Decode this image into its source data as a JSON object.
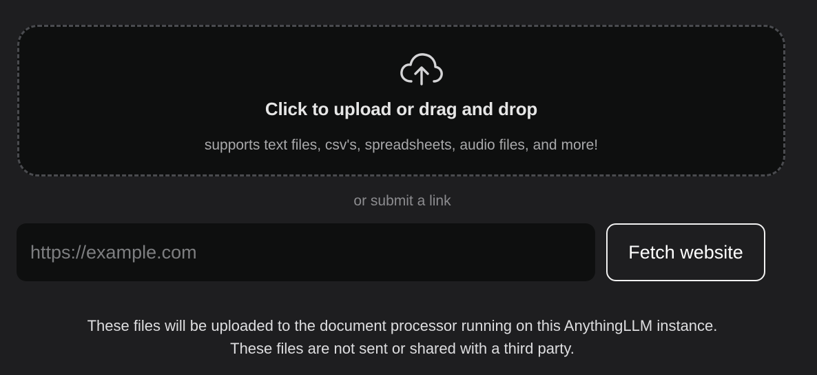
{
  "upload": {
    "icon": "cloud-upload-icon",
    "title": "Click to upload or drag and drop",
    "subtitle": "supports text files, csv's, spreadsheets, audio files, and more!"
  },
  "link_section": {
    "label": "or submit a link",
    "url_placeholder": "https://example.com",
    "url_value": "",
    "fetch_label": "Fetch website"
  },
  "notice": {
    "line1": "These files will be uploaded to the document processor running on this AnythingLLM instance.",
    "line2": "These files are not sent or shared with a third party."
  },
  "colors": {
    "background": "#1e1e20",
    "panel": "#0e0f0f",
    "dashed_border": "#4a4b4f",
    "text_primary": "#e6e6e6",
    "text_muted": "#a9a9ab"
  }
}
